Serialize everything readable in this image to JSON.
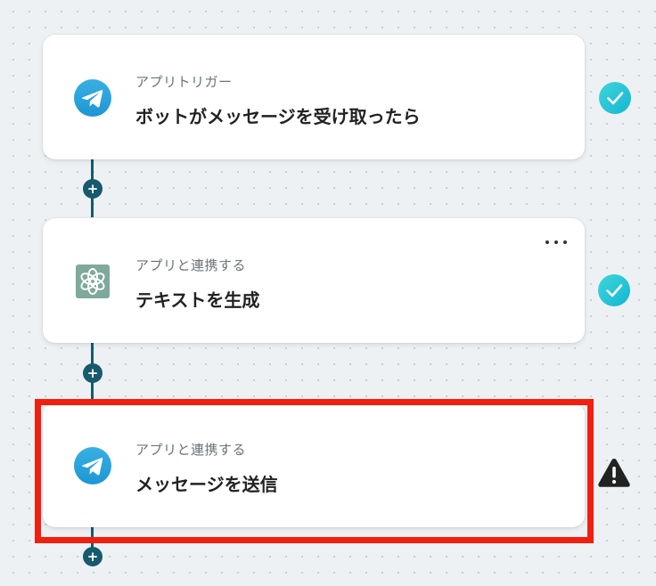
{
  "flow": {
    "steps": [
      {
        "subtitle": "アプリトリガー",
        "title": "ボットがメッセージを受け取ったら",
        "app_icon": "telegram-icon",
        "status": "success"
      },
      {
        "subtitle": "アプリと連携する",
        "title": "テキストを生成",
        "app_icon": "chatgpt-icon",
        "status": "success"
      },
      {
        "subtitle": "アプリと連携する",
        "title": "メッセージを送信",
        "app_icon": "telegram-icon",
        "status": "warning"
      }
    ],
    "add_label": "+"
  },
  "colors": {
    "connector": "#175a6e",
    "success": "#1fc7d6",
    "warning": "#222222",
    "highlight": "#f21f10",
    "telegram": "#2aa3e0",
    "chatgpt": "#7ea99c"
  }
}
